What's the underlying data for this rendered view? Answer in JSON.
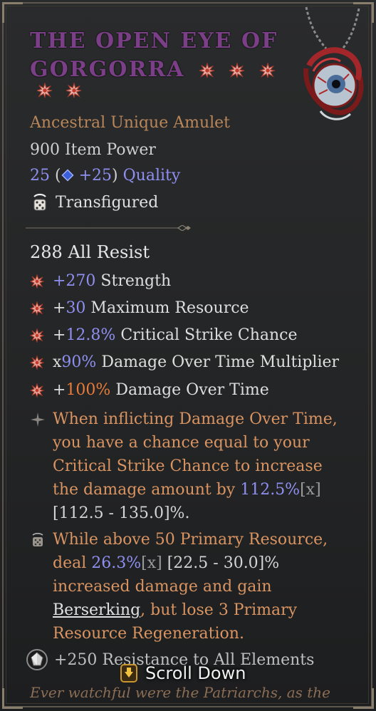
{
  "item": {
    "name": "THE OPEN EYE OF GORGORRA",
    "name_line1": "THE OPEN EYE OF",
    "name_line2": "GORGORRA",
    "type": "Ancestral Unique Amulet",
    "item_power": "900 Item Power",
    "quality_value": "25",
    "quality_bonus": "+25",
    "quality_label": "Quality",
    "transfigured": "Transfigured",
    "base_stat": "288 All Resist"
  },
  "affixes": [
    {
      "prefix": "",
      "value": "+270",
      "label": " Strength",
      "color": "blue"
    },
    {
      "prefix": "+",
      "value": "30",
      "label": " Maximum Resource",
      "color": "blue"
    },
    {
      "prefix": "+",
      "value": "12.8%",
      "label": " Critical Strike Chance",
      "color": "blue"
    },
    {
      "prefix": "x",
      "value": "90%",
      "label": " Damage Over Time Multiplier",
      "color": "blue"
    },
    {
      "prefix": "+",
      "value": "100%",
      "label": " Damage Over Time",
      "color": "orange"
    }
  ],
  "unique_power": {
    "text_a": "When inflicting Damage Over Time, you have a chance equal to your Critical Strike Chance to increase the damage amount by ",
    "value": "112.5%",
    "tag": "[x]",
    "range": " [112.5 - 135.0]%."
  },
  "transfigured_power": {
    "text_a": "While above 50 Primary Resource, deal ",
    "value": "26.3%",
    "tag": "[x]",
    "range": " [22.5 - 30.0]%",
    "text_b": " increased damage and gain ",
    "keyword": "Berserking",
    "text_c": ", but lose 3 Primary Resource Regeneration."
  },
  "socket_bonus": "+250 Resistance to All Elements",
  "flavor_text": "Ever watchful were the Patriarchs, as the",
  "scroll_hint": "Scroll Down",
  "colors": {
    "title": "#7a3f86",
    "unique_orange": "#d99462",
    "value_blue": "#8f8ff0",
    "gem_red": "#c0392b"
  },
  "icons": {
    "gem": "red-star-gem-icon",
    "transfigured": "transfigured-dice-icon",
    "affix_bullet": "red-star-bullet-icon",
    "unique_bullet": "gray-star-bullet-icon",
    "socket": "socket-gem-icon",
    "scroll_key": "scroll-key-icon"
  }
}
